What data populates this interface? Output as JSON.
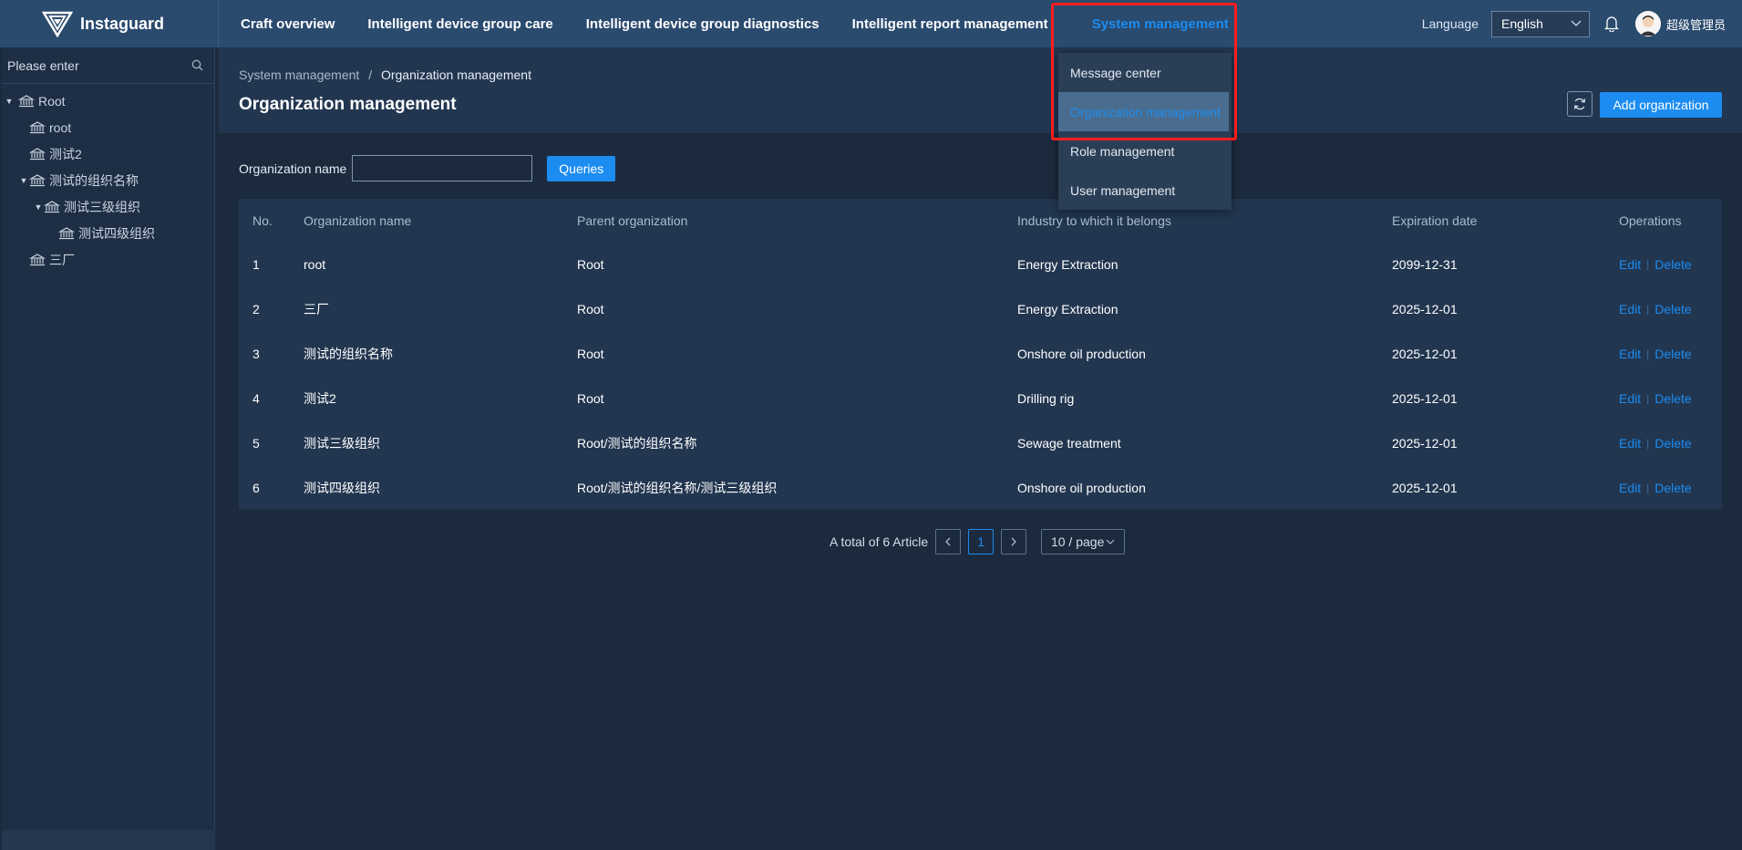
{
  "header": {
    "brand": "Instaguard",
    "nav": [
      {
        "label": "Craft overview"
      },
      {
        "label": "Intelligent device group care"
      },
      {
        "label": "Intelligent device group diagnostics"
      },
      {
        "label": "Intelligent report management"
      },
      {
        "label": "System management",
        "active": true
      }
    ],
    "language_label": "Language",
    "language_value": "English",
    "username": "超级管理员"
  },
  "dropdown": {
    "items": [
      {
        "label": "Message center"
      },
      {
        "label": "Organization management",
        "active": true
      },
      {
        "label": "Role management"
      },
      {
        "label": "User management"
      }
    ]
  },
  "sidebar": {
    "search_placeholder": "Please enter",
    "tree": [
      {
        "label": "Root",
        "expanded": true
      },
      {
        "label": "root"
      },
      {
        "label": "测试2"
      },
      {
        "label": "测试的组织名称",
        "expanded": true
      },
      {
        "label": "测试三级组织",
        "expanded": true
      },
      {
        "label": "测试四级组织"
      },
      {
        "label": "三厂"
      }
    ]
  },
  "page": {
    "breadcrumb_parent": "System management",
    "breadcrumb_separator": "/",
    "breadcrumb_current": "Organization management",
    "title": "Organization management",
    "add_button": "Add organization"
  },
  "filter": {
    "label": "Organization name",
    "value": "",
    "query_button": "Queries"
  },
  "table": {
    "columns": [
      "No.",
      "Organization name",
      "Parent organization",
      "Industry to which it belongs",
      "Expiration date",
      "Operations"
    ],
    "rows": [
      {
        "no": "1",
        "name": "root",
        "parent": "Root",
        "industry": "Energy Extraction",
        "expiration": "2099-12-31"
      },
      {
        "no": "2",
        "name": "三厂",
        "parent": "Root",
        "industry": "Energy Extraction",
        "expiration": "2025-12-01"
      },
      {
        "no": "3",
        "name": "测试的组织名称",
        "parent": "Root",
        "industry": "Onshore oil production",
        "expiration": "2025-12-01"
      },
      {
        "no": "4",
        "name": "测试2",
        "parent": "Root",
        "industry": "Drilling rig",
        "expiration": "2025-12-01"
      },
      {
        "no": "5",
        "name": "测试三级组织",
        "parent": "Root/测试的组织名称",
        "industry": "Sewage treatment",
        "expiration": "2025-12-01"
      },
      {
        "no": "6",
        "name": "测试四级组织",
        "parent": "Root/测试的组织名称/测试三级组织",
        "industry": "Onshore oil production",
        "expiration": "2025-12-01"
      }
    ],
    "edit_label": "Edit",
    "delete_label": "Delete",
    "op_separator": "|"
  },
  "pagination": {
    "total_text": "A total of 6 Article",
    "current_page": "1",
    "page_size": "10 / page"
  },
  "colors": {
    "topbar": "#2a4a6e",
    "accent": "#1c8cf0",
    "highlight": "#ff1e1e",
    "background": "#1b2a3d"
  },
  "icons": [
    "logo-icon",
    "search-icon",
    "chevron-down-icon",
    "bell-icon",
    "avatar-icon",
    "bank-icon",
    "caret-down-icon",
    "refresh-icon",
    "chevron-left-icon",
    "chevron-right-icon"
  ]
}
